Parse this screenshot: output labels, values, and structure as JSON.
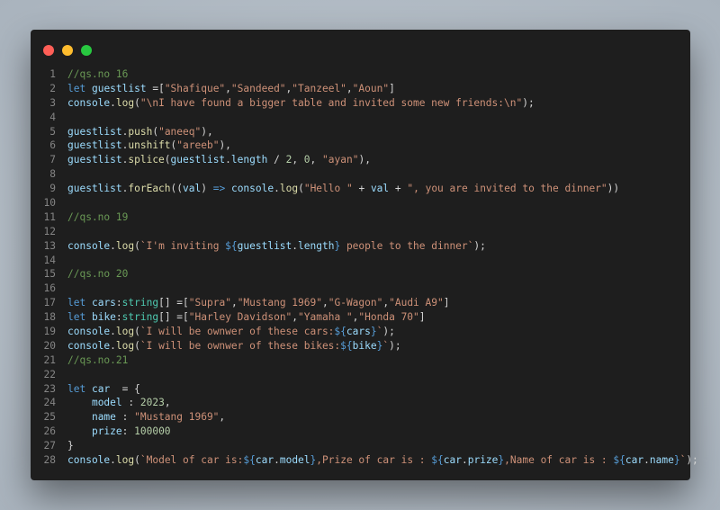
{
  "window": {
    "controls": [
      "close",
      "minimize",
      "maximize"
    ],
    "colors": {
      "close": "#ff5f57",
      "minimize": "#febc2e",
      "maximize": "#28c840",
      "background": "#1e1e1e"
    }
  },
  "code_lines": [
    {
      "n": "1",
      "tokens": [
        [
          "cm",
          "//qs.no 16"
        ]
      ]
    },
    {
      "n": "2",
      "tokens": [
        [
          "kw",
          "let"
        ],
        [
          "pn",
          " "
        ],
        [
          "vr",
          "guestlist"
        ],
        [
          "pn",
          " =["
        ],
        [
          "st",
          "\"Shafique\""
        ],
        [
          "pn",
          ","
        ],
        [
          "st",
          "\"Sandeed\""
        ],
        [
          "pn",
          ","
        ],
        [
          "st",
          "\"Tanzeel\""
        ],
        [
          "pn",
          ","
        ],
        [
          "st",
          "\"Aoun\""
        ],
        [
          "pn",
          "]"
        ]
      ]
    },
    {
      "n": "3",
      "tokens": [
        [
          "vr",
          "console"
        ],
        [
          "pn",
          "."
        ],
        [
          "fn",
          "log"
        ],
        [
          "pn",
          "("
        ],
        [
          "st",
          "\"\\nI have found a bigger table and invited some new friends:\\n\""
        ],
        [
          "pn",
          ");"
        ]
      ]
    },
    {
      "n": "4",
      "tokens": []
    },
    {
      "n": "5",
      "tokens": [
        [
          "vr",
          "guestlist"
        ],
        [
          "pn",
          "."
        ],
        [
          "fn",
          "push"
        ],
        [
          "pn",
          "("
        ],
        [
          "st",
          "\"aneeq\""
        ],
        [
          "pn",
          "),"
        ]
      ]
    },
    {
      "n": "6",
      "tokens": [
        [
          "vr",
          "guestlist"
        ],
        [
          "pn",
          "."
        ],
        [
          "fn",
          "unshift"
        ],
        [
          "pn",
          "("
        ],
        [
          "st",
          "\"areeb\""
        ],
        [
          "pn",
          "),"
        ]
      ]
    },
    {
      "n": "7",
      "tokens": [
        [
          "vr",
          "guestlist"
        ],
        [
          "pn",
          "."
        ],
        [
          "fn",
          "splice"
        ],
        [
          "pn",
          "("
        ],
        [
          "vr",
          "guestlist"
        ],
        [
          "pn",
          "."
        ],
        [
          "vr",
          "length"
        ],
        [
          "pn",
          " / "
        ],
        [
          "nm",
          "2"
        ],
        [
          "pn",
          ", "
        ],
        [
          "nm",
          "0"
        ],
        [
          "pn",
          ", "
        ],
        [
          "st",
          "\"ayan\""
        ],
        [
          "pn",
          "),"
        ]
      ]
    },
    {
      "n": "8",
      "tokens": []
    },
    {
      "n": "9",
      "tokens": [
        [
          "vr",
          "guestlist"
        ],
        [
          "pn",
          "."
        ],
        [
          "fn",
          "forEach"
        ],
        [
          "pn",
          "(("
        ],
        [
          "vr",
          "val"
        ],
        [
          "pn",
          ") "
        ],
        [
          "kw",
          "=>"
        ],
        [
          "pn",
          " "
        ],
        [
          "vr",
          "console"
        ],
        [
          "pn",
          "."
        ],
        [
          "fn",
          "log"
        ],
        [
          "pn",
          "("
        ],
        [
          "st",
          "\"Hello \""
        ],
        [
          "pn",
          " + "
        ],
        [
          "vr",
          "val"
        ],
        [
          "pn",
          " + "
        ],
        [
          "st",
          "\", you are invited to the dinner\""
        ],
        [
          "pn",
          "))"
        ]
      ]
    },
    {
      "n": "10",
      "tokens": []
    },
    {
      "n": "11",
      "tokens": [
        [
          "cm",
          "//qs.no 19"
        ]
      ]
    },
    {
      "n": "12",
      "tokens": []
    },
    {
      "n": "13",
      "tokens": [
        [
          "vr",
          "console"
        ],
        [
          "pn",
          "."
        ],
        [
          "fn",
          "log"
        ],
        [
          "pn",
          "("
        ],
        [
          "st",
          "`I'm inviting "
        ],
        [
          "ip",
          "${"
        ],
        [
          "vr",
          "guestlist"
        ],
        [
          "pn",
          "."
        ],
        [
          "vr",
          "length"
        ],
        [
          "ip",
          "}"
        ],
        [
          "st",
          " people to the dinner`"
        ],
        [
          "pn",
          ");"
        ]
      ]
    },
    {
      "n": "14",
      "tokens": []
    },
    {
      "n": "15",
      "tokens": [
        [
          "cm",
          "//qs.no 20"
        ]
      ]
    },
    {
      "n": "16",
      "tokens": []
    },
    {
      "n": "17",
      "tokens": [
        [
          "kw",
          "let"
        ],
        [
          "pn",
          " "
        ],
        [
          "vr",
          "cars"
        ],
        [
          "pn",
          ":"
        ],
        [
          "ty",
          "string"
        ],
        [
          "pn",
          "[] =["
        ],
        [
          "st",
          "\"Supra\""
        ],
        [
          "pn",
          ","
        ],
        [
          "st",
          "\"Mustang 1969\""
        ],
        [
          "pn",
          ","
        ],
        [
          "st",
          "\"G-Wagon\""
        ],
        [
          "pn",
          ","
        ],
        [
          "st",
          "\"Audi A9\""
        ],
        [
          "pn",
          "]"
        ]
      ]
    },
    {
      "n": "18",
      "tokens": [
        [
          "kw",
          "let"
        ],
        [
          "pn",
          " "
        ],
        [
          "vr",
          "bike"
        ],
        [
          "pn",
          ":"
        ],
        [
          "ty",
          "string"
        ],
        [
          "pn",
          "[] =["
        ],
        [
          "st",
          "\"Harley Davidson\""
        ],
        [
          "pn",
          ","
        ],
        [
          "st",
          "\"Yamaha \""
        ],
        [
          "pn",
          ","
        ],
        [
          "st",
          "\"Honda 70\""
        ],
        [
          "pn",
          "]"
        ]
      ]
    },
    {
      "n": "19",
      "tokens": [
        [
          "vr",
          "console"
        ],
        [
          "pn",
          "."
        ],
        [
          "fn",
          "log"
        ],
        [
          "pn",
          "("
        ],
        [
          "st",
          "`I will be ownwer of these cars:"
        ],
        [
          "ip",
          "${"
        ],
        [
          "vr",
          "cars"
        ],
        [
          "ip",
          "}"
        ],
        [
          "st",
          "`"
        ],
        [
          "pn",
          ");"
        ]
      ]
    },
    {
      "n": "20",
      "tokens": [
        [
          "vr",
          "console"
        ],
        [
          "pn",
          "."
        ],
        [
          "fn",
          "log"
        ],
        [
          "pn",
          "("
        ],
        [
          "st",
          "`I will be ownwer of these bikes:"
        ],
        [
          "ip",
          "${"
        ],
        [
          "vr",
          "bike"
        ],
        [
          "ip",
          "}"
        ],
        [
          "st",
          "`"
        ],
        [
          "pn",
          ");"
        ]
      ]
    },
    {
      "n": "21",
      "tokens": [
        [
          "cm",
          "//qs.no.21"
        ]
      ]
    },
    {
      "n": "22",
      "tokens": []
    },
    {
      "n": "23",
      "tokens": [
        [
          "kw",
          "let"
        ],
        [
          "pn",
          " "
        ],
        [
          "vr",
          "car"
        ],
        [
          "pn",
          "  = {"
        ]
      ]
    },
    {
      "n": "24",
      "tokens": [
        [
          "pn",
          "    "
        ],
        [
          "vr",
          "model"
        ],
        [
          "pn",
          " : "
        ],
        [
          "nm",
          "2023"
        ],
        [
          "pn",
          ","
        ]
      ]
    },
    {
      "n": "25",
      "tokens": [
        [
          "pn",
          "    "
        ],
        [
          "vr",
          "name"
        ],
        [
          "pn",
          " : "
        ],
        [
          "st",
          "\"Mustang 1969\""
        ],
        [
          "pn",
          ","
        ]
      ]
    },
    {
      "n": "26",
      "tokens": [
        [
          "pn",
          "    "
        ],
        [
          "vr",
          "prize"
        ],
        [
          "pn",
          ": "
        ],
        [
          "nm",
          "100000"
        ]
      ]
    },
    {
      "n": "27",
      "tokens": [
        [
          "pn",
          "}"
        ]
      ]
    },
    {
      "n": "28",
      "tokens": [
        [
          "vr",
          "console"
        ],
        [
          "pn",
          "."
        ],
        [
          "fn",
          "log"
        ],
        [
          "pn",
          "("
        ],
        [
          "st",
          "`Model of car is:"
        ],
        [
          "ip",
          "${"
        ],
        [
          "vr",
          "car"
        ],
        [
          "pn",
          "."
        ],
        [
          "vr",
          "model"
        ],
        [
          "ip",
          "}"
        ],
        [
          "st",
          ",Prize of car is : "
        ],
        [
          "ip",
          "${"
        ],
        [
          "vr",
          "car"
        ],
        [
          "pn",
          "."
        ],
        [
          "vr",
          "prize"
        ],
        [
          "ip",
          "}"
        ],
        [
          "st",
          ",Name of car is : "
        ],
        [
          "ip",
          "${"
        ],
        [
          "vr",
          "car"
        ],
        [
          "pn",
          "."
        ],
        [
          "vr",
          "name"
        ],
        [
          "ip",
          "}"
        ],
        [
          "st",
          "`"
        ],
        [
          "pn",
          ");"
        ]
      ]
    }
  ]
}
